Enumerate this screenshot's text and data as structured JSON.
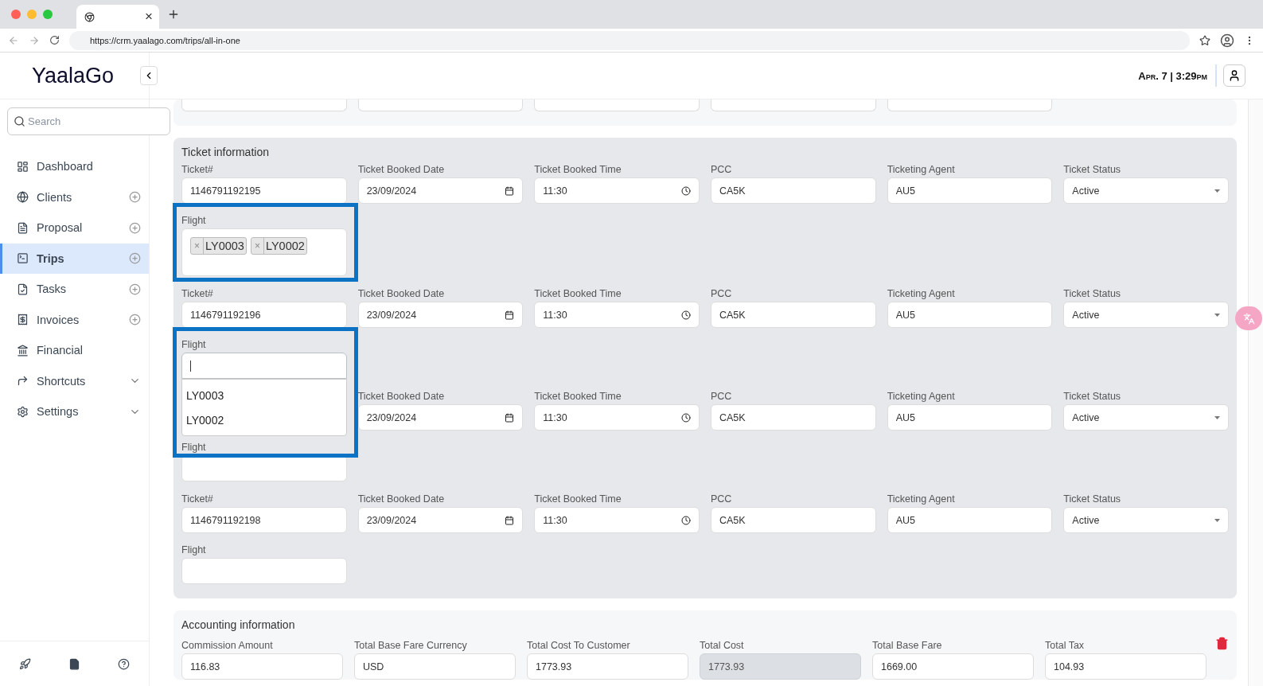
{
  "browser": {
    "tab_close": "×",
    "url": "https://crm.yaalago.com/trips/all-in-one"
  },
  "header": {
    "logo": "YaalaGo",
    "datetime": "Apr. 7 | 3:29pm"
  },
  "sidebar": {
    "search": {
      "placeholder": "Search"
    },
    "items": [
      {
        "label": "Dashboard",
        "kind": "plain",
        "selected": false
      },
      {
        "label": "Clients",
        "kind": "addable",
        "selected": false
      },
      {
        "label": "Proposal",
        "kind": "addable",
        "selected": false
      },
      {
        "label": "Trips",
        "kind": "addable",
        "selected": true
      },
      {
        "label": "Tasks",
        "kind": "addable",
        "selected": false
      },
      {
        "label": "Invoices",
        "kind": "addable",
        "selected": false
      },
      {
        "label": "Financial",
        "kind": "plain",
        "selected": false
      },
      {
        "label": "Shortcuts",
        "kind": "expandable",
        "selected": false
      },
      {
        "label": "Settings",
        "kind": "expandable",
        "selected": false
      }
    ]
  },
  "ticket_information": {
    "title": "Ticket information",
    "tickets": [
      {
        "fields": [
          {
            "kind": "text",
            "label": "Ticket#",
            "value": "1146791192195"
          },
          {
            "kind": "date",
            "label": "Ticket Booked Date",
            "value": "23/09/2024"
          },
          {
            "kind": "time",
            "label": "Ticket Booked Time",
            "value": "11:30"
          },
          {
            "kind": "text",
            "label": "PCC",
            "value": "CA5K"
          },
          {
            "kind": "text",
            "label": "Ticketing Agent",
            "value": "AU5"
          },
          {
            "kind": "select",
            "label": "Ticket Status",
            "value": "Active"
          }
        ],
        "flight": {
          "label": "Flight",
          "annotated": true,
          "tags": [
            {
              "remove": "×",
              "code": "LY0003"
            },
            {
              "remove": "×",
              "code": "LY0002"
            }
          ]
        }
      },
      {
        "fields": [
          {
            "kind": "text",
            "label": "Ticket#",
            "value": "1146791192196"
          },
          {
            "kind": "date",
            "label": "Ticket Booked Date",
            "value": "23/09/2024"
          },
          {
            "kind": "time",
            "label": "Ticket Booked Time",
            "value": "11:30"
          },
          {
            "kind": "text",
            "label": "PCC",
            "value": "CA5K"
          },
          {
            "kind": "text",
            "label": "Ticketing Agent",
            "value": "AU5"
          },
          {
            "kind": "select",
            "label": "Ticket Status",
            "value": "Active"
          }
        ],
        "flight": {
          "label": "Flight",
          "annotated": true,
          "focused": true,
          "options": [
            "LY0003",
            "LY0002"
          ]
        }
      },
      {
        "fields": [
          {
            "kind": "hidden"
          },
          {
            "kind": "date",
            "label": "Ticket Booked Date",
            "value": "23/09/2024"
          },
          {
            "kind": "time",
            "label": "Ticket Booked Time",
            "value": "11:30"
          },
          {
            "kind": "text",
            "label": "PCC",
            "value": "CA5K"
          },
          {
            "kind": "text",
            "label": "Ticketing Agent",
            "value": "AU5"
          },
          {
            "kind": "select",
            "label": "Ticket Status",
            "value": "Active"
          }
        ],
        "flight": {
          "label": "Flight",
          "annotated": false,
          "focused": false
        }
      },
      {
        "fields": [
          {
            "kind": "text",
            "label": "Ticket#",
            "value": "1146791192198"
          },
          {
            "kind": "date",
            "label": "Ticket Booked Date",
            "value": "23/09/2024"
          },
          {
            "kind": "time",
            "label": "Ticket Booked Time",
            "value": "11:30"
          },
          {
            "kind": "text",
            "label": "PCC",
            "value": "CA5K"
          },
          {
            "kind": "text",
            "label": "Ticketing Agent",
            "value": "AU5"
          },
          {
            "kind": "select",
            "label": "Ticket Status",
            "value": "Active"
          }
        ],
        "flight": {
          "label": "Flight",
          "annotated": false,
          "focused": false
        }
      }
    ]
  },
  "accounting_information": {
    "title": "Accounting information",
    "fields": [
      {
        "label": "Commission Amount",
        "value": "116.83",
        "disabled": false
      },
      {
        "label": "Total Base Fare Currency",
        "value": "USD",
        "disabled": false
      },
      {
        "label": "Total Cost To Customer",
        "value": "1773.93",
        "disabled": false
      },
      {
        "label": "Total Cost",
        "value": "1773.93",
        "disabled": true
      },
      {
        "label": "Total Base Fare",
        "value": "1669.00",
        "disabled": false
      },
      {
        "label": "Total Tax",
        "value": "104.93",
        "disabled": false
      }
    ]
  }
}
